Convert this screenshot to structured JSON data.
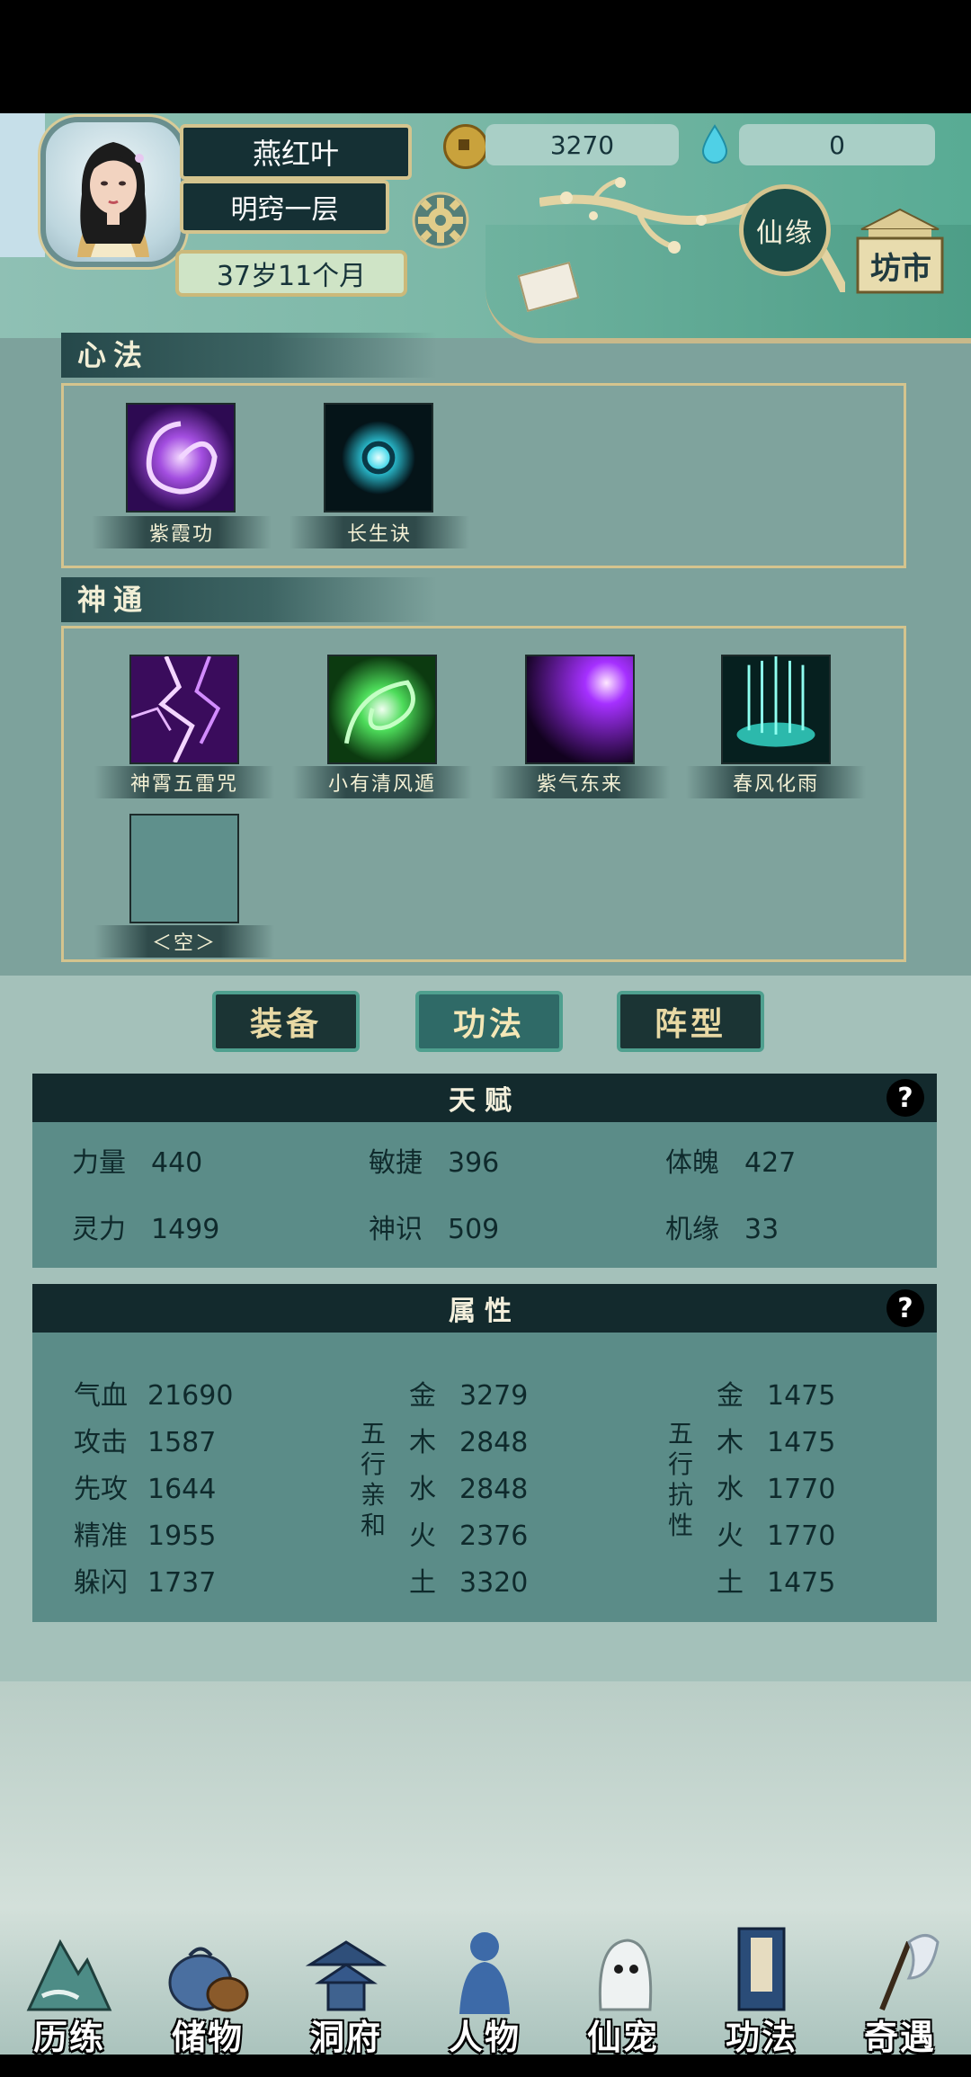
{
  "header": {
    "player_name": "燕红叶",
    "realm": "明窍一层",
    "age": "37岁11个月",
    "coins": "3270",
    "gems": "0",
    "xianyuan_label": "仙缘",
    "fangshi_label": "坊市"
  },
  "xinfa": {
    "title": "心法",
    "skills": [
      {
        "name": "紫霞功",
        "icon": "purple-swirl-icon"
      },
      {
        "name": "长生诀",
        "icon": "cyan-orb-icon"
      }
    ]
  },
  "shentong": {
    "title": "神通",
    "skills": [
      {
        "name": "神霄五雷咒",
        "icon": "purple-lightning-icon"
      },
      {
        "name": "小有清风遁",
        "icon": "green-vortex-icon"
      },
      {
        "name": "紫气东来",
        "icon": "violet-glow-icon"
      },
      {
        "name": "春风化雨",
        "icon": "teal-rain-icon"
      },
      {
        "name": "＜空＞",
        "icon": "empty-slot"
      }
    ]
  },
  "tabs": [
    "装备",
    "功法",
    "阵型"
  ],
  "active_tab": "功法",
  "talent": {
    "title": "天赋",
    "help": "?",
    "stats": [
      {
        "label": "力量",
        "value": "440"
      },
      {
        "label": "敏捷",
        "value": "396"
      },
      {
        "label": "体魄",
        "value": "427"
      },
      {
        "label": "灵力",
        "value": "1499"
      },
      {
        "label": "神识",
        "value": "509"
      },
      {
        "label": "机缘",
        "value": "33"
      }
    ]
  },
  "attributes": {
    "title": "属性",
    "help": "?",
    "basic": [
      {
        "label": "气血",
        "value": "21690"
      },
      {
        "label": "攻击",
        "value": "1587"
      },
      {
        "label": "先攻",
        "value": "1644"
      },
      {
        "label": "精准",
        "value": "1955"
      },
      {
        "label": "躲闪",
        "value": "1737"
      }
    ],
    "affinity_title": "五行亲和",
    "affinity": [
      {
        "label": "金",
        "value": "3279"
      },
      {
        "label": "木",
        "value": "2848"
      },
      {
        "label": "水",
        "value": "2848"
      },
      {
        "label": "火",
        "value": "2376"
      },
      {
        "label": "土",
        "value": "3320"
      }
    ],
    "resist_title": "五行抗性",
    "resist": [
      {
        "label": "金",
        "value": "1475"
      },
      {
        "label": "木",
        "value": "1475"
      },
      {
        "label": "水",
        "value": "1770"
      },
      {
        "label": "火",
        "value": "1770"
      },
      {
        "label": "土",
        "value": "1475"
      }
    ]
  },
  "nav": [
    "历练",
    "储物",
    "洞府",
    "人物",
    "仙宠",
    "功法",
    "奇遇"
  ],
  "colors": {
    "accent_gold": "#d4c48e",
    "panel_dark": "#132a2d",
    "panel_teal": "#5b8c88"
  }
}
